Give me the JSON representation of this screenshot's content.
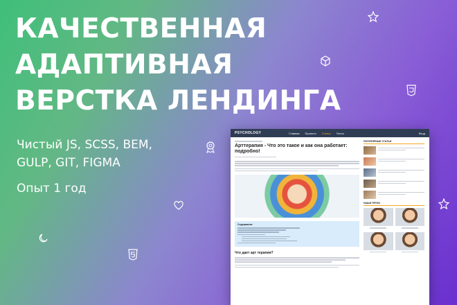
{
  "headline": [
    "КАЧЕСТВЕННАЯ",
    "АДАПТИВНАЯ",
    "ВЕРСТКА ЛЕНДИНГА"
  ],
  "tech": [
    "Чистый JS, SCSS, BEM,",
    "GULP, GIT, FIGMA"
  ],
  "experience": "Опыт 1 год",
  "mockup": {
    "logo": "PSYCHOLOGY",
    "nav": [
      "Главная",
      "Проекты",
      "Статьи",
      "Тесты"
    ],
    "login": "Вход",
    "title": "Арттерапия - Что это такое и как она работает: подробно!",
    "toc_title": "Содержание",
    "section_title": "Что дает арт терапия?",
    "popular_title": "ПОПУЛЯРНЫЕ СТАТЬИ",
    "heroes_title": "НАШИ ГЕРОИ"
  },
  "icons": [
    "star-icon",
    "cube-icon",
    "css3-icon",
    "badge-icon",
    "heart-icon",
    "star-icon",
    "moon-icon",
    "html5-icon"
  ]
}
